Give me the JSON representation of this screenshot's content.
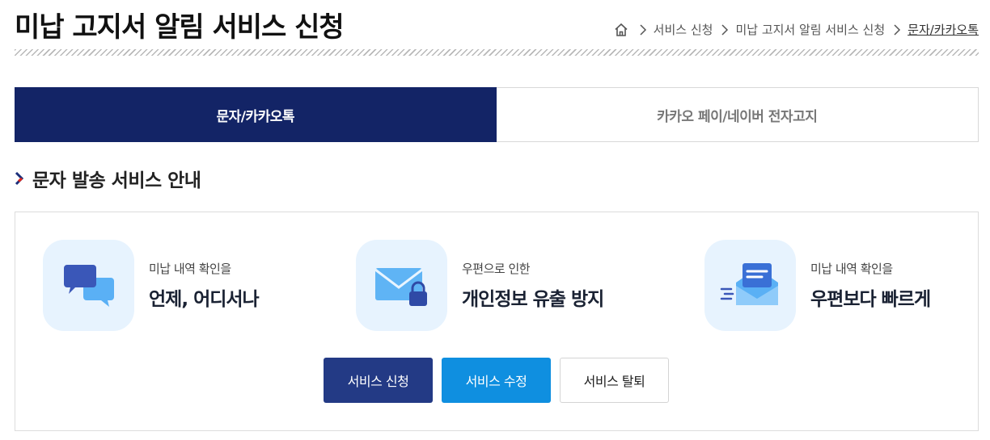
{
  "header": {
    "title": "미납 고지서 알림 서비스 신청",
    "breadcrumb": [
      {
        "icon": "home-icon"
      },
      {
        "label": "서비스 신청"
      },
      {
        "label": "미납 고지서 알림 서비스 신청"
      },
      {
        "label": "문자/카카오톡",
        "current": true
      }
    ]
  },
  "tabs": [
    {
      "label": "문자/카카오톡",
      "active": true
    },
    {
      "label": "카카오 페이/네이버 전자고지",
      "active": false
    }
  ],
  "section": {
    "title": "문자 발송 서비스 안내",
    "features": [
      {
        "icon": "chat-bubbles-icon",
        "sub": "미납 내역 확인을",
        "main": "언제, 어디서나"
      },
      {
        "icon": "locked-envelope-icon",
        "sub": "우편으로 인한",
        "main": "개인정보 유출 방지"
      },
      {
        "icon": "fast-mail-icon",
        "sub": "미납 내역 확인을",
        "main": "우편보다 빠르게"
      }
    ]
  },
  "buttons": {
    "apply": "서비스 신청",
    "modify": "서비스 수정",
    "withdraw": "서비스 탈퇴"
  },
  "colors": {
    "active_tab": "#132466",
    "apply_button": "#233a85",
    "modify_button": "#0f8fe0",
    "icon_background": "#e7f3fe"
  }
}
